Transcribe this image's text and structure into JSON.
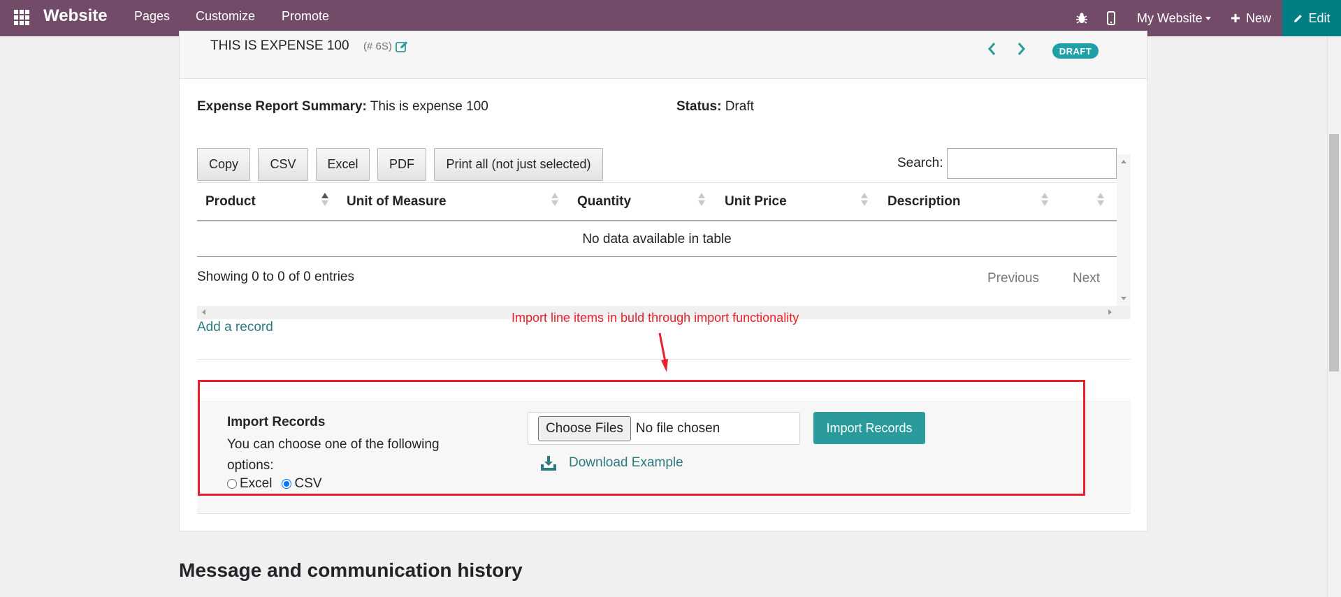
{
  "navbar": {
    "brand": "Website",
    "menu": [
      "Pages",
      "Customize",
      "Promote"
    ],
    "website_selector": "My Website",
    "new_label": "New",
    "edit_label": "Edit"
  },
  "record": {
    "title": "THIS IS EXPENSE 100",
    "ref": "(# 6S)",
    "status_badge": "DRAFT",
    "summary_label": "Expense Report Summary:",
    "summary_value": "This is expense 100",
    "status_label": "Status:",
    "status_value": "Draft"
  },
  "table_tools": {
    "buttons": [
      "Copy",
      "CSV",
      "Excel",
      "PDF",
      "Print all (not just selected)"
    ],
    "search_label": "Search:",
    "search_value": ""
  },
  "table": {
    "columns": [
      "Product",
      "Unit of Measure",
      "Quantity",
      "Unit Price",
      "Description",
      ""
    ],
    "sorted_column": "Product",
    "empty_message": "No data available in table",
    "info": "Showing 0 to 0 of 0 entries",
    "prev_label": "Previous",
    "next_label": "Next"
  },
  "add_record_label": "Add a record",
  "annotation_text": "Import line items in buld through import functionality",
  "import": {
    "title": "Import Records",
    "description": "You can choose one of the following options:",
    "options": [
      "Excel",
      "CSV"
    ],
    "selected_option": "CSV",
    "choose_files_label": "Choose Files",
    "no_file_label": "No file chosen",
    "import_button_label": "Import Records",
    "download_label": "Download Example"
  },
  "history_title": "Message and communication history",
  "colors": {
    "navbar": "#714b67",
    "edit_button": "#017e84",
    "accent": "#2a9a9a",
    "annotation": "#e8202b"
  }
}
